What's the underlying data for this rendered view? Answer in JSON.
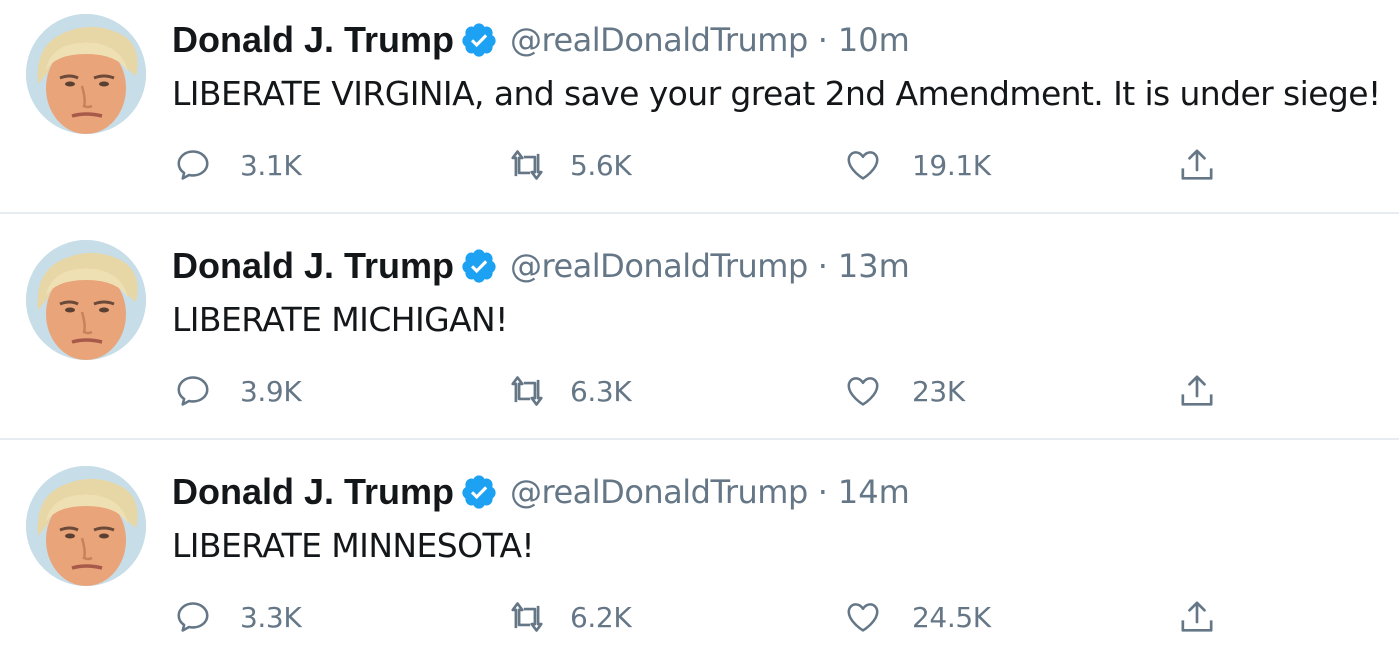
{
  "colors": {
    "text": "#14171a",
    "muted": "#657786",
    "verified": "#1da1f2",
    "divider": "#e6ecf0"
  },
  "icons": {
    "reply": "speech-bubble-icon",
    "retweet": "retweet-arrows-icon",
    "like": "heart-icon",
    "share": "share-upload-icon",
    "verified": "verified-badge-icon"
  },
  "tweets": [
    {
      "name": "Donald J. Trump",
      "handle": "@realDonaldTrump",
      "separator": "·",
      "time": "10m",
      "text": "LIBERATE VIRGINIA, and save your great 2nd Amendment. It is under siege!",
      "replies": "3.1K",
      "retweets": "5.6K",
      "likes": "19.1K"
    },
    {
      "name": "Donald J. Trump",
      "handle": "@realDonaldTrump",
      "separator": "·",
      "time": "13m",
      "text": "LIBERATE MICHIGAN!",
      "replies": "3.9K",
      "retweets": "6.3K",
      "likes": "23K"
    },
    {
      "name": "Donald J. Trump",
      "handle": "@realDonaldTrump",
      "separator": "·",
      "time": "14m",
      "text": "LIBERATE MINNESOTA!",
      "replies": "3.3K",
      "retweets": "6.2K",
      "likes": "24.5K"
    }
  ]
}
